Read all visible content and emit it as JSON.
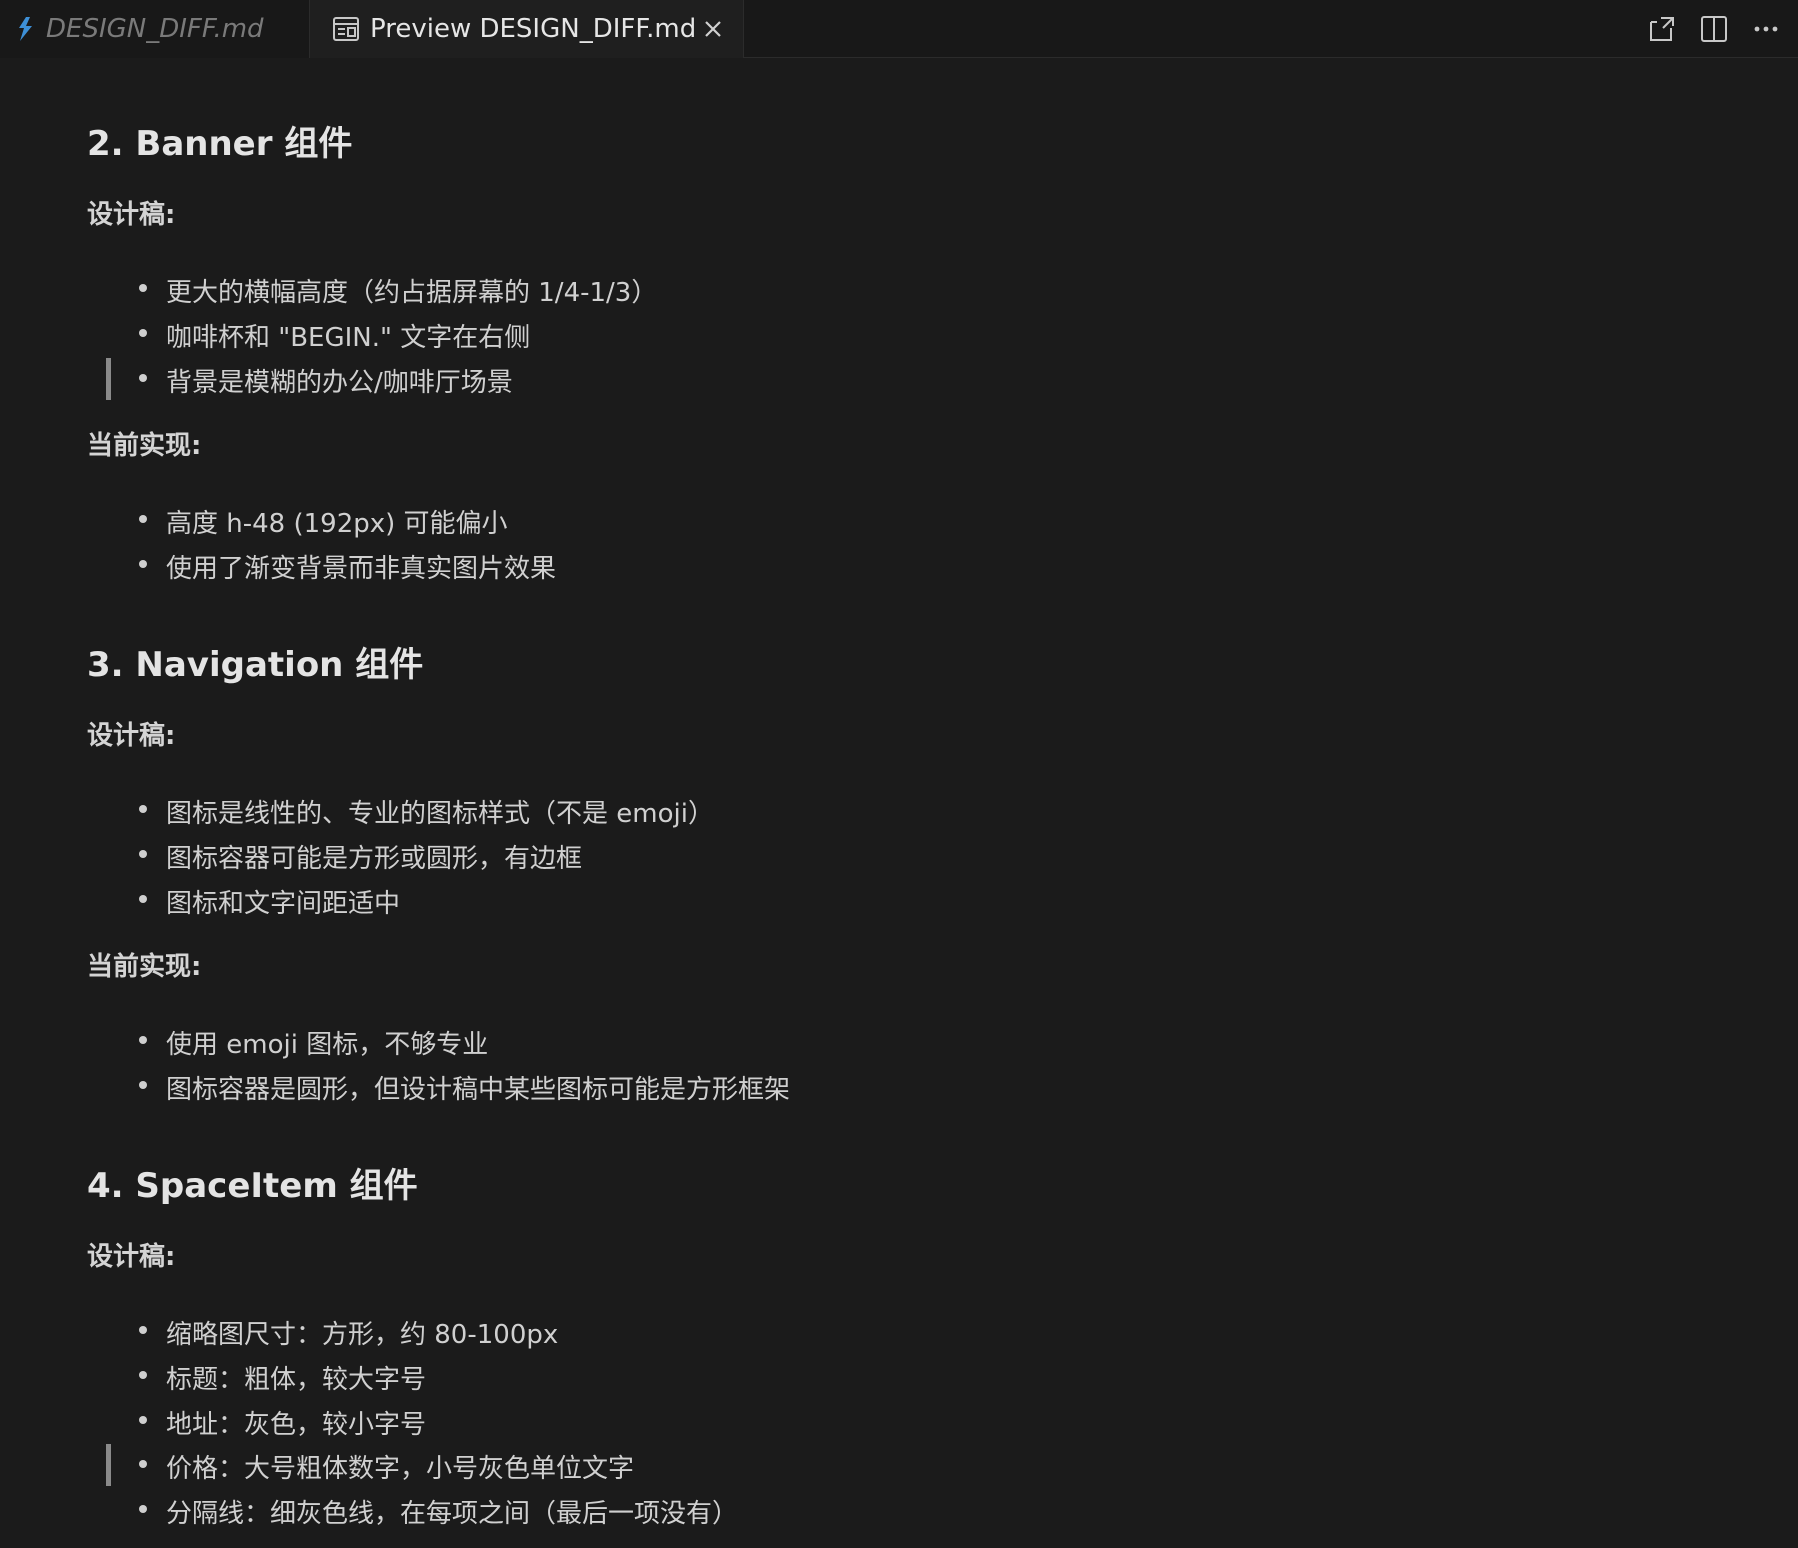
{
  "tabs": [
    {
      "label": "DESIGN_DIFF.md",
      "active": false,
      "icon": "markdown-icon"
    },
    {
      "label": "Preview DESIGN_DIFF.md",
      "active": true,
      "icon": "preview-icon"
    }
  ],
  "actions": [
    {
      "name": "open-source-icon"
    },
    {
      "name": "split-editor-icon"
    },
    {
      "name": "more-actions-icon",
      "glyph": "···"
    }
  ],
  "doc": {
    "sections": [
      {
        "heading": "2. Banner 组件",
        "design_label": "设计稿:",
        "design_items": [
          "更大的横幅高度（约占据屏幕的 1/4-1/3）",
          "咖啡杯和 \"BEGIN.\" 文字在右侧",
          "背景是模糊的办公/咖啡厅场景"
        ],
        "current_label": "当前实现:",
        "current_items": [
          "高度 h-48 (192px) 可能偏小",
          "使用了渐变背景而非真实图片效果"
        ]
      },
      {
        "heading": "3. Navigation 组件",
        "design_label": "设计稿:",
        "design_items": [
          "图标是线性的、专业的图标样式（不是 emoji）",
          "图标容器可能是方形或圆形，有边框",
          "图标和文字间距适中"
        ],
        "current_label": "当前实现:",
        "current_items": [
          "使用 emoji 图标，不够专业",
          "图标容器是圆形，但设计稿中某些图标可能是方形框架"
        ]
      },
      {
        "heading": "4. SpaceItem 组件",
        "design_label": "设计稿:",
        "design_items": [
          "缩略图尺寸：方形，约 80-100px",
          "标题：粗体，较大字号",
          "地址：灰色，较小字号",
          "价格：大号粗体数字，小号灰色单位文字",
          "分隔线：细灰色线，在每项之间（最后一项没有）"
        ]
      }
    ]
  }
}
